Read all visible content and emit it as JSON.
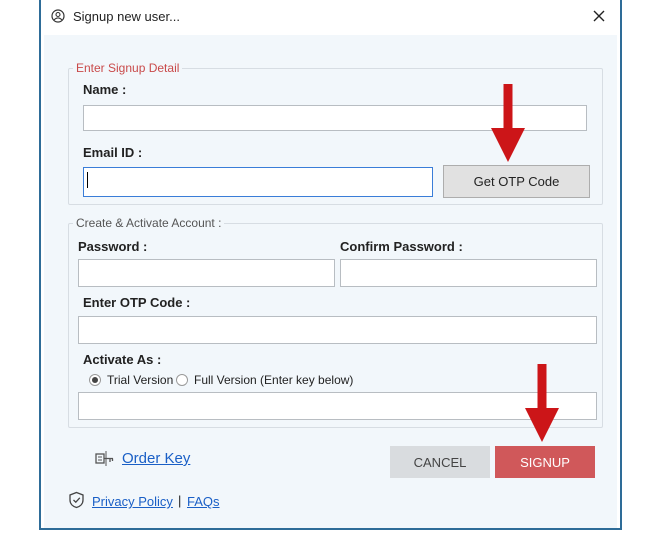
{
  "window": {
    "title": "Signup new user...",
    "close_label": "✕"
  },
  "signup_detail": {
    "legend": "Enter Signup Detail",
    "name_label": "Name :",
    "name_value": "",
    "email_label": "Email ID :",
    "email_value": "",
    "get_otp_label": "Get OTP Code"
  },
  "create_account": {
    "legend": "Create & Activate Account :",
    "password_label": "Password :",
    "password_value": "",
    "confirm_password_label": "Confirm Password :",
    "confirm_password_value": "",
    "otp_label": "Enter OTP Code :",
    "otp_value": "",
    "activate_as_label": "Activate As :",
    "options": [
      {
        "label": "Trial Version",
        "selected": true
      },
      {
        "label": "Full Version (Enter key below)",
        "selected": false
      }
    ],
    "key_value": ""
  },
  "footer": {
    "order_key_label": "Order Key",
    "cancel_label": "CANCEL",
    "signup_label": "SIGNUP",
    "privacy_label": "Privacy Policy",
    "separator": "|",
    "faqs_label": "FAQs"
  },
  "colors": {
    "accent_red": "#d0585a",
    "arrow_red": "#cc1518",
    "link_blue": "#1a5fc6",
    "legend_red": "#c94a4a",
    "panel_bg": "#f2f7fb"
  },
  "icons": [
    "user-circle-icon",
    "close-icon",
    "order-key-icon",
    "shield-check-icon",
    "down-arrow-icon"
  ]
}
